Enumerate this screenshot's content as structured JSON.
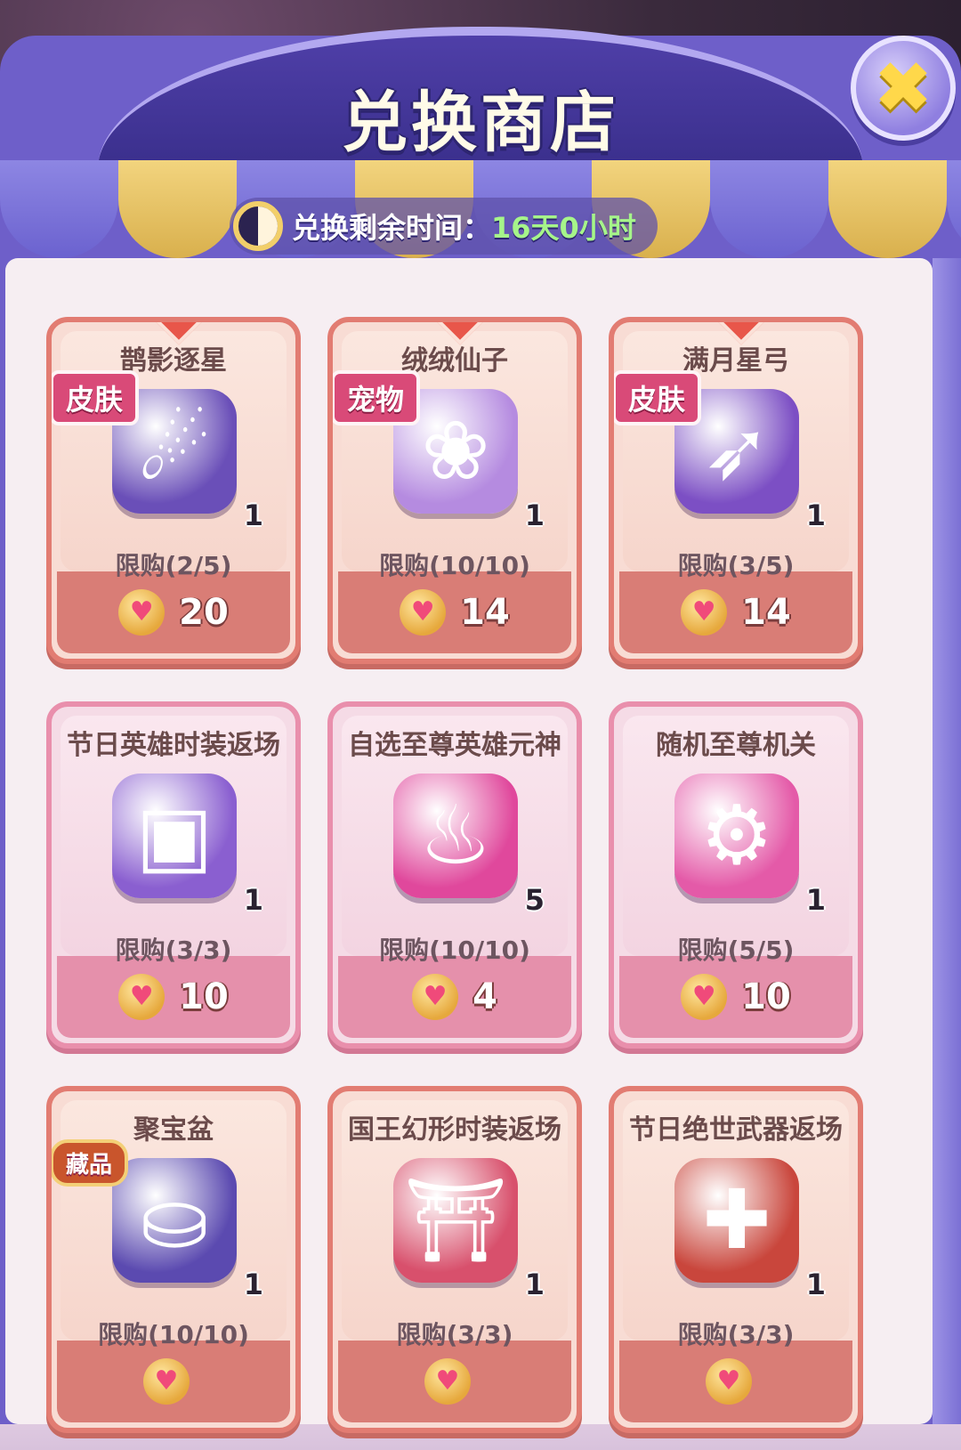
{
  "title": "兑换商店",
  "close_icon": "close-icon",
  "timer": {
    "label": "兑换剩余时间：",
    "value": "16天0小时"
  },
  "colors": {
    "frame": "#6e5fc9",
    "awning_gold": "#e2bd5e",
    "awning_blue": "#7c74d9",
    "timer_value": "#a6f58a",
    "price_skin": "#d97d76",
    "price_pink": "#e590ab"
  },
  "cards": [
    {
      "name": "鹊影逐星",
      "badge": "皮肤",
      "qty": "1",
      "limit": "限购(2/5)",
      "price": "20",
      "style": "skin",
      "icon": "hero-skin-icon"
    },
    {
      "name": "绒绒仙子",
      "badge": "宠物",
      "qty": "1",
      "limit": "限购(10/10)",
      "price": "14",
      "style": "skin",
      "icon": "pet-icon"
    },
    {
      "name": "满月星弓",
      "badge": "皮肤",
      "qty": "1",
      "limit": "限购(3/5)",
      "price": "14",
      "style": "skin",
      "icon": "bow-icon"
    },
    {
      "name": "节日英雄时装返场",
      "badge": "",
      "qty": "1",
      "limit": "限购(3/3)",
      "price": "10",
      "style": "pink",
      "icon": "chest-icon"
    },
    {
      "name": "自选至尊英雄元神",
      "badge": "",
      "qty": "5",
      "limit": "限购(10/10)",
      "price": "4",
      "style": "pink",
      "icon": "spirit-flame-icon"
    },
    {
      "name": "随机至尊机关",
      "badge": "",
      "qty": "1",
      "limit": "限购(5/5)",
      "price": "10",
      "style": "pink",
      "icon": "gear-cube-icon"
    },
    {
      "name": "聚宝盆",
      "badge": "藏品",
      "qty": "1",
      "limit": "限购(10/10)",
      "price": "",
      "style": "skin",
      "icon": "treasure-bowl-icon"
    },
    {
      "name": "国王幻形时装返场",
      "badge": "",
      "qty": "1",
      "limit": "限购(3/3)",
      "price": "",
      "style": "skin",
      "icon": "lantern-box-icon"
    },
    {
      "name": "节日绝世武器返场",
      "badge": "",
      "qty": "1",
      "limit": "限购(3/3)",
      "price": "",
      "style": "skin",
      "icon": "gift-box-icon"
    }
  ],
  "price_icon": "heart-coin-icon"
}
